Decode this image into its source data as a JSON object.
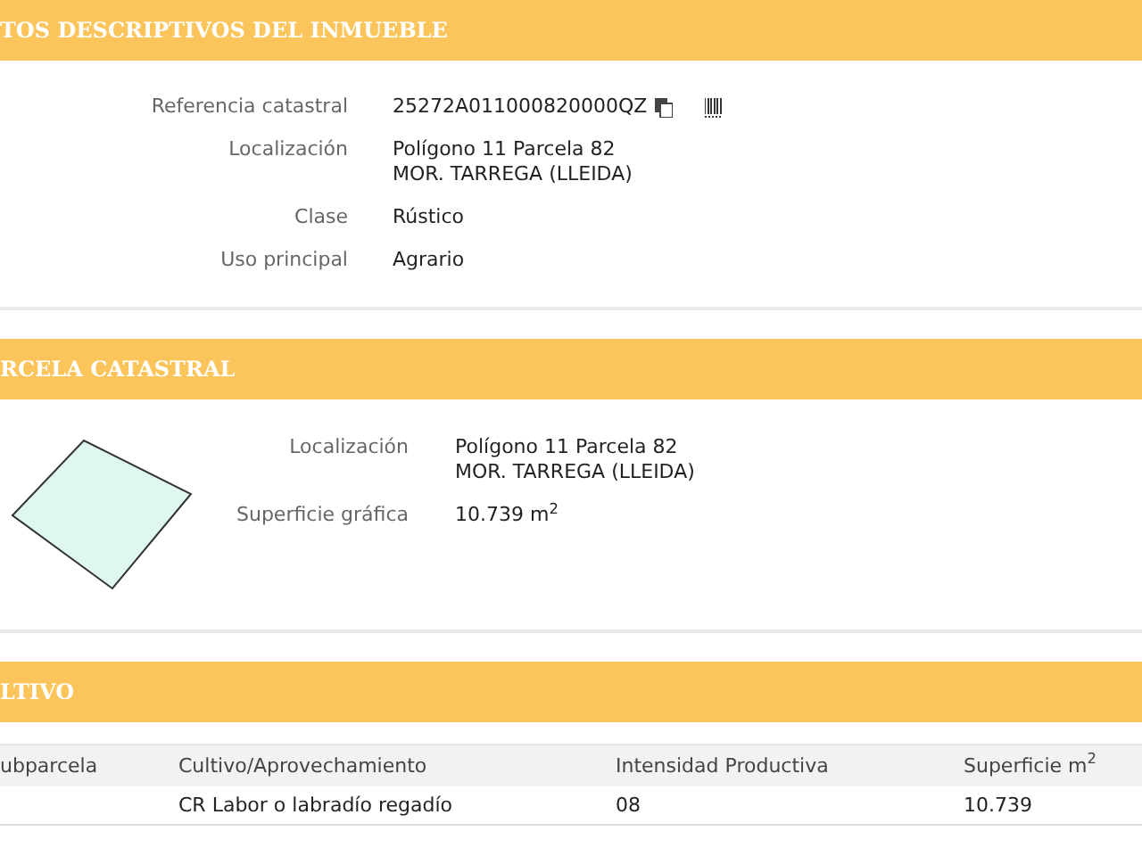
{
  "sections": [
    {
      "title": "TOS DESCRIPTIVOS DEL INMUEBLE",
      "kind": "fields",
      "fields": [
        {
          "label": "Referencia catastral",
          "lines": [
            "25272A011000820000QZ"
          ],
          "kind": "reference"
        },
        {
          "label": "Localización",
          "lines": [
            "Polígono 11 Parcela 82",
            "MOR. TARREGA (LLEIDA)"
          ],
          "kind": "text"
        },
        {
          "label": "Clase",
          "lines": [
            "Rústico"
          ],
          "kind": "text"
        },
        {
          "label": "Uso principal",
          "lines": [
            "Agrario"
          ],
          "kind": "text"
        }
      ]
    },
    {
      "title": "RCELA CATASTRAL",
      "kind": "parcel",
      "fields": [
        {
          "label": "Localización",
          "lines": [
            "Polígono 11 Parcela 82",
            "MOR. TARREGA (LLEIDA)"
          ],
          "kind": "text"
        },
        {
          "label": "Superficie gráfica",
          "lines": [
            "10.739 m$^{2}$"
          ],
          "kind": "text"
        }
      ]
    },
    {
      "title": "LTIVO",
      "kind": "table",
      "table": {
        "columns": [
          "ubparcela",
          "Cultivo/Aprovechamiento",
          "Intensidad Productiva",
          "Superficie m$^{2}$"
        ],
        "rows": [
          [
            "",
            "CR Labor o labradío regadío",
            "08",
            "10.739"
          ]
        ]
      }
    }
  ]
}
